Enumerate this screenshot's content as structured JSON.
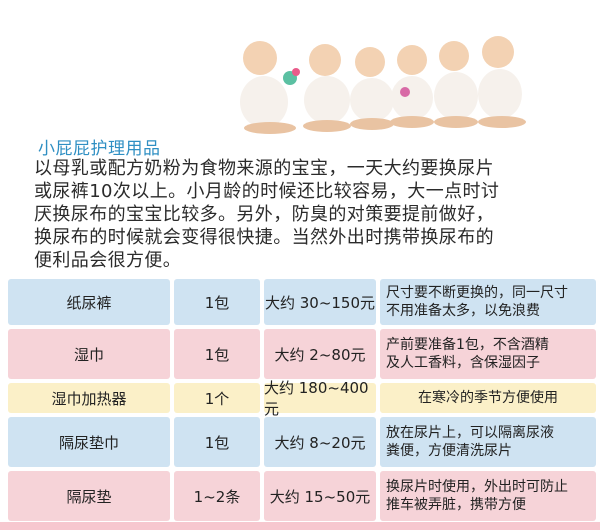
{
  "heading": "小屁屁护理用品",
  "paragraph_lines": [
    "以母乳或配方奶粉为食物来源的宝宝，一天大约要换尿片",
    "或尿裤10次以上。小月龄的时候还比较容易，大一点时讨",
    "厌换尿布的宝宝比较多。另外，防臭的对策要提前做好，",
    "换尿布的时候就会变得很快捷。当然外出时携带换尿布的",
    "便利品会很方便。"
  ],
  "table": {
    "rows": [
      {
        "item": "纸尿裤",
        "qty": "1包",
        "price": "大约 30~150元",
        "note": "尺寸要不断更换的，同一尺寸\n不用准备太多，以免浪费",
        "color": "#cfe3f2"
      },
      {
        "item": "湿巾",
        "qty": "1包",
        "price": "大约 2~80元",
        "note": "产前要准备1包，不含酒精\n及人工香料，含保湿因子",
        "color": "#f6d3d8"
      },
      {
        "item": "湿巾加热器",
        "qty": "1个",
        "price": "大约 180~400元",
        "note": "在寒冷的季节方便使用",
        "color": "#fbf0c8"
      },
      {
        "item": "隔尿垫巾",
        "qty": "1包",
        "price": "大约 8~20元",
        "note": "放在尿片上，可以隔离尿液\n粪便，方便清洗尿片",
        "color": "#cfe3f2"
      },
      {
        "item": "隔尿垫",
        "qty": "1~2条",
        "price": "大约 15~50元",
        "note": "换尿片时使用，外出时可防止\n推车被弄脏，携带方便",
        "color": "#f6d3d8"
      }
    ]
  }
}
